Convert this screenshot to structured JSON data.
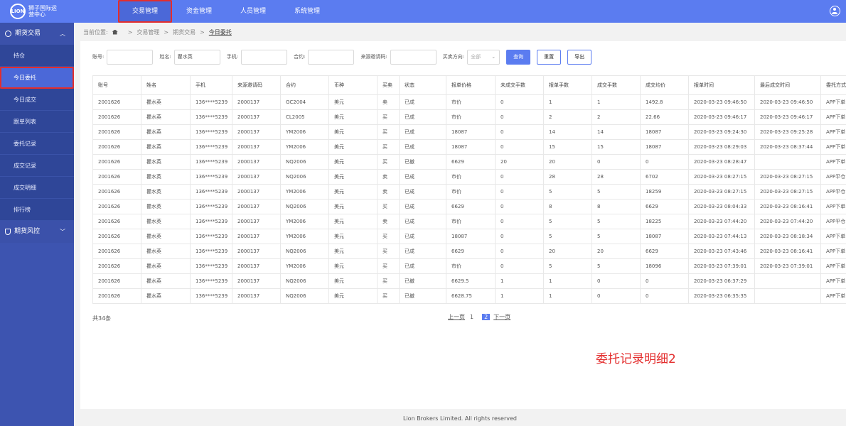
{
  "logo": {
    "mark": "LION",
    "text": "狮子国际运营中心"
  },
  "topnav": [
    {
      "label": "交易管理"
    },
    {
      "label": "资金管理"
    },
    {
      "label": "人员管理"
    },
    {
      "label": "系统管理"
    }
  ],
  "sidebar": {
    "group1": "期货交易",
    "items": [
      "持仓",
      "今日委托",
      "今日成交",
      "跟单列表",
      "委托记录",
      "成交记录",
      "成交明细",
      "排行榜"
    ],
    "group2": "期货风控"
  },
  "breadcrumb": {
    "prefix": "当前位置:",
    "level1": "交易管理",
    "level2": "期货交易",
    "current": "今日委托"
  },
  "filters": {
    "account_label": "账号:",
    "account_value": "",
    "name_label": "姓名:",
    "name_value": "瞿水英",
    "phone_label": "手机:",
    "phone_value": "",
    "contract_label": "合约:",
    "contract_value": "",
    "invite_label": "来源邀请码:",
    "invite_value": "",
    "direction_label": "买卖方向:",
    "direction_value": "全部",
    "query_btn": "查询",
    "reset_btn": "重置",
    "export_btn": "导出"
  },
  "table": {
    "headers": [
      "账号",
      "姓名",
      "手机",
      "来源邀请码",
      "合约",
      "币种",
      "买卖",
      "状态",
      "报单价格",
      "未成交手数",
      "报单手数",
      "成交手数",
      "成交均价",
      "报单时间",
      "最后成交时间",
      "委托方式"
    ],
    "rows": [
      [
        "2001626",
        "瞿水英",
        "136****5239",
        "2000137",
        "GC2004",
        "美元",
        "卖",
        "已成",
        "市价",
        "0",
        "1",
        "1",
        "1492.8",
        "2020-03-23 09:46:50",
        "2020-03-23 09:46:50",
        "APP下单"
      ],
      [
        "2001626",
        "瞿水英",
        "136****5239",
        "2000137",
        "CL2005",
        "美元",
        "买",
        "已成",
        "市价",
        "0",
        "2",
        "2",
        "22.66",
        "2020-03-23 09:46:17",
        "2020-03-23 09:46:17",
        "APP下单"
      ],
      [
        "2001626",
        "瞿水英",
        "136****5239",
        "2000137",
        "YM2006",
        "美元",
        "买",
        "已成",
        "18087",
        "0",
        "14",
        "14",
        "18087",
        "2020-03-23 09:24:30",
        "2020-03-23 09:25:28",
        "APP下单"
      ],
      [
        "2001626",
        "瞿水英",
        "136****5239",
        "2000137",
        "YM2006",
        "美元",
        "买",
        "已成",
        "18087",
        "0",
        "15",
        "15",
        "18087",
        "2020-03-23 08:29:03",
        "2020-03-23 08:37:44",
        "APP下单"
      ],
      [
        "2001626",
        "瞿水英",
        "136****5239",
        "2000137",
        "NQ2006",
        "美元",
        "买",
        "已撤",
        "6629",
        "20",
        "20",
        "0",
        "0",
        "2020-03-23 08:28:47",
        "",
        "APP下单"
      ],
      [
        "2001626",
        "瞿水英",
        "136****5239",
        "2000137",
        "NQ2006",
        "美元",
        "卖",
        "已成",
        "市价",
        "0",
        "28",
        "28",
        "6702",
        "2020-03-23 08:27:15",
        "2020-03-23 08:27:15",
        "APP平仓"
      ],
      [
        "2001626",
        "瞿水英",
        "136****5239",
        "2000137",
        "YM2006",
        "美元",
        "卖",
        "已成",
        "市价",
        "0",
        "5",
        "5",
        "18259",
        "2020-03-23 08:27:15",
        "2020-03-23 08:27:15",
        "APP平仓"
      ],
      [
        "2001626",
        "瞿水英",
        "136****5239",
        "2000137",
        "NQ2006",
        "美元",
        "买",
        "已成",
        "6629",
        "0",
        "8",
        "8",
        "6629",
        "2020-03-23 08:04:33",
        "2020-03-23 08:16:41",
        "APP下单"
      ],
      [
        "2001626",
        "瞿水英",
        "136****5239",
        "2000137",
        "YM2006",
        "美元",
        "卖",
        "已成",
        "市价",
        "0",
        "5",
        "5",
        "18225",
        "2020-03-23 07:44:20",
        "2020-03-23 07:44:20",
        "APP平仓"
      ],
      [
        "2001626",
        "瞿水英",
        "136****5239",
        "2000137",
        "YM2006",
        "美元",
        "买",
        "已成",
        "18087",
        "0",
        "5",
        "5",
        "18087",
        "2020-03-23 07:44:13",
        "2020-03-23 08:18:34",
        "APP下单"
      ],
      [
        "2001626",
        "瞿水英",
        "136****5239",
        "2000137",
        "NQ2006",
        "美元",
        "买",
        "已成",
        "6629",
        "0",
        "20",
        "20",
        "6629",
        "2020-03-23 07:43:46",
        "2020-03-23 08:16:41",
        "APP下单"
      ],
      [
        "2001626",
        "瞿水英",
        "136****5239",
        "2000137",
        "YM2006",
        "美元",
        "买",
        "已成",
        "市价",
        "0",
        "5",
        "5",
        "18096",
        "2020-03-23 07:39:01",
        "2020-03-23 07:39:01",
        "APP下单"
      ],
      [
        "2001626",
        "瞿水英",
        "136****5239",
        "2000137",
        "NQ2006",
        "美元",
        "买",
        "已撤",
        "6629.5",
        "1",
        "1",
        "0",
        "0",
        "2020-03-23 06:37:29",
        "",
        "APP下单"
      ],
      [
        "2001626",
        "瞿水英",
        "136****5239",
        "2000137",
        "NQ2006",
        "美元",
        "买",
        "已撤",
        "6628.75",
        "1",
        "1",
        "0",
        "0",
        "2020-03-23 06:35:35",
        "",
        "APP下单"
      ]
    ]
  },
  "pagination": {
    "total": "共34条",
    "prev": "上一页",
    "page1": "1",
    "page2": "2",
    "next": "下一页"
  },
  "annotation": "委托记录明细2",
  "footer": "Lion Brokers Limited. All rights reserved",
  "colors": {
    "primary": "#5b7cf0",
    "sidebar": "#3d54b0",
    "highlight": "#e32d2d"
  }
}
